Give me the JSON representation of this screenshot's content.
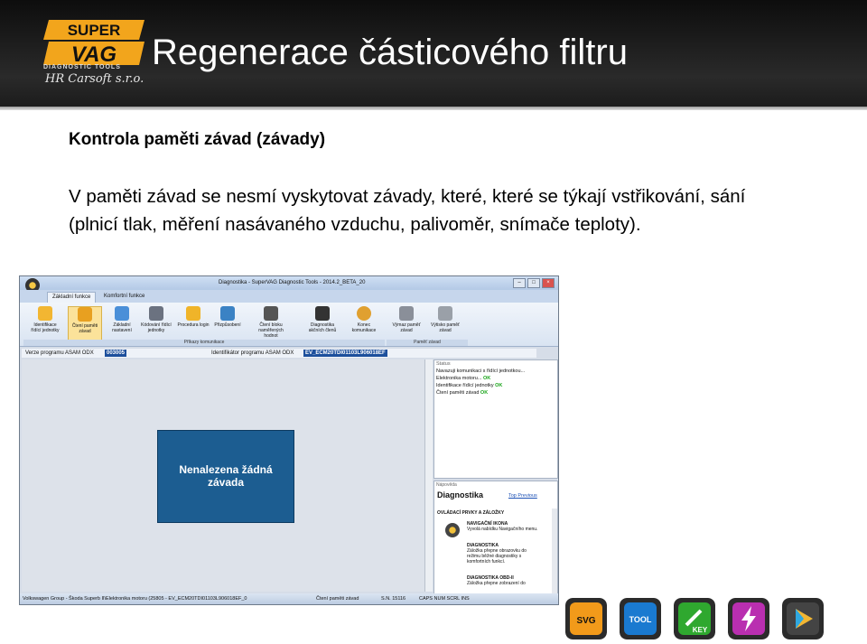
{
  "slide": {
    "title": "Regenerace částicového filtru",
    "subtitle": "Kontrola paměti závad (závady)",
    "paragraph": "V paměti závad se nesmí vyskytovat závady, které, které se týkají vstřikování, sání (plnicí tlak, měření nasávaného vzduchu, palivoměr, snímače teploty)."
  },
  "logo": {
    "brand_top": "SUPER",
    "brand_bottom": "VAG",
    "tagline": "DIAGNOSTIC TOOLS",
    "company": "HR Carsoft s.r.o."
  },
  "app": {
    "window_title": "Diagnostika - SuperVAG Diagnostic Tools - 2014.2_BETA_20",
    "tabs": [
      "Základní funkce",
      "Komfortní funkce"
    ],
    "ribbon_buttons": [
      {
        "label": "Identifikace řídící jednotky",
        "icon": "info-icon"
      },
      {
        "label": "Čtení paměti závad",
        "icon": "read-memory-icon"
      },
      {
        "label": "Základní nastavení",
        "icon": "basic-settings-icon"
      },
      {
        "label": "Kódování řídící jednotky",
        "icon": "coding-icon"
      },
      {
        "label": "Procedura login",
        "icon": "lock-icon"
      },
      {
        "label": "Přizpůsobení",
        "icon": "adaptation-icon"
      },
      {
        "label": "Čtení bloku naměřených hodnot",
        "icon": "measured-values-icon"
      },
      {
        "label": "Diagnostika akčních členů",
        "icon": "actuators-icon"
      },
      {
        "label": "Konec komunikace",
        "icon": "end-communication-icon"
      },
      {
        "label": "Výmaz paměť závad",
        "icon": "erase-icon"
      },
      {
        "label": "Výtisko paměť závad",
        "icon": "print-icon"
      }
    ],
    "ribbon_groups": [
      "Příkazy komunikace",
      "Paměť závad"
    ],
    "asam_label": "Verze programu ASAM ODX",
    "asam_value": "003005",
    "ident_label": "Identifikátor programu ASAM ODX",
    "ident_value": "EV_ECM20TDI01103L906018EF",
    "no_fault_line1": "Nenalezena žádná",
    "no_fault_line2": "závada",
    "status_title": "Status",
    "status_rows": [
      {
        "text": "Navazuji komunikaci s řídící jednotkou...",
        "ok": ""
      },
      {
        "text": "Elektronika motoru... ",
        "ok": "OK"
      },
      {
        "text": "Identifikace řídící jednotky ",
        "ok": "OK"
      },
      {
        "text": "Čtení paměti závad ",
        "ok": "OK"
      }
    ],
    "help": {
      "pane_title": "Nápověda",
      "heading": "Diagnostika",
      "link_top": "Top",
      "link_prev": "Previous",
      "section": "OVLÁDACÍ PRVKY A ZÁLOŽKY",
      "items": [
        {
          "title": "NAVIGAČNÍ IKONA",
          "text": "Vyvolá nabídku Navigačního menu."
        },
        {
          "title": "DIAGNOSTIKA",
          "text": "Záložka přepne obrazovku do režimu běžné diagnostiky s komfortních funkcí."
        },
        {
          "title": "DIAGNOSTIKA OBD-II",
          "text": "Záložka přepne zobrazení do"
        }
      ]
    },
    "statusbar": {
      "vehicle": "Volkswagen Group - Škoda Superb II\\Elektronika motoru (25805 - EV_ECM20TDI01103L906018EF_0",
      "mode": "Čtení paměti závad",
      "sn": "S.N. 15116",
      "keys": "CAPS  NUM  SCRL  INS"
    }
  },
  "bottom_icons": [
    {
      "name": "svg-icon",
      "label": "SVG",
      "color": "#f29a1a"
    },
    {
      "name": "tool-icon",
      "label": "TOOL",
      "color": "#1a7ad0"
    },
    {
      "name": "key-icon",
      "label": "KEY",
      "color": "#2fa82f"
    },
    {
      "name": "lightning-icon",
      "label": "",
      "color": "#b92fb0"
    },
    {
      "name": "play-icon",
      "label": "",
      "color": "#333333"
    }
  ]
}
